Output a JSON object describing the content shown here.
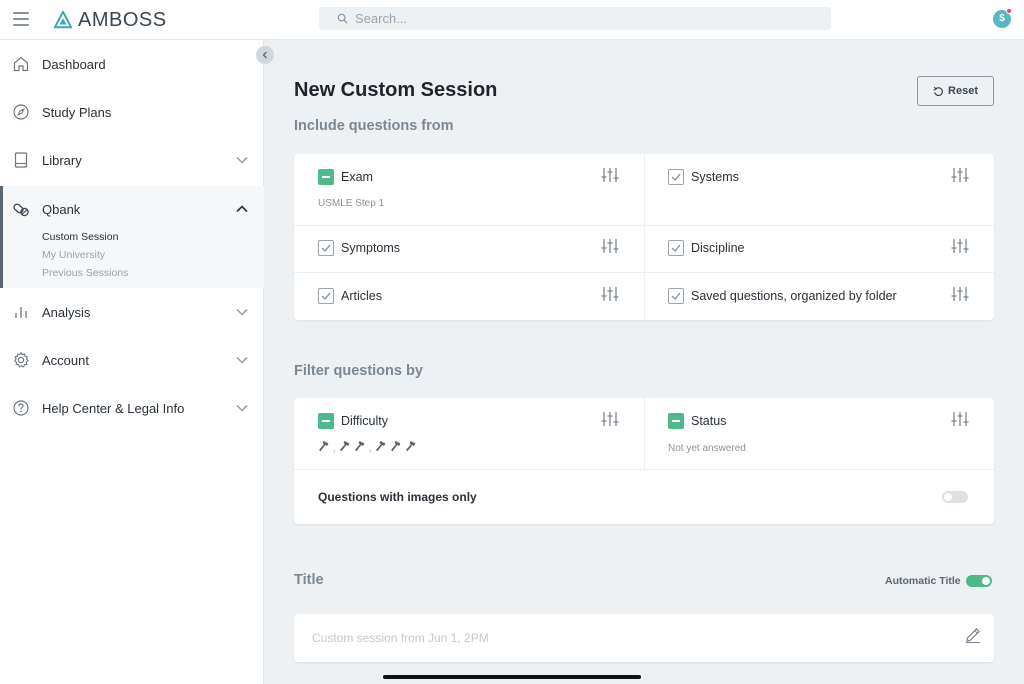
{
  "app": {
    "logo_text": "AMBOSS",
    "avatar_letter": "$"
  },
  "search": {
    "placeholder": "Search..."
  },
  "sidebar": {
    "items": [
      {
        "label": "Dashboard"
      },
      {
        "label": "Study Plans"
      },
      {
        "label": "Library"
      },
      {
        "label": "Qbank",
        "expanded": true,
        "sub_items": [
          {
            "label": "Custom Session",
            "active": true
          },
          {
            "label": "My University"
          },
          {
            "label": "Previous Sessions"
          }
        ]
      },
      {
        "label": "Analysis"
      },
      {
        "label": "Account"
      },
      {
        "label": "Help Center & Legal Info"
      }
    ]
  },
  "main": {
    "title": "New Custom Session",
    "reset_label": "Reset",
    "include_heading": "Include questions from",
    "include": {
      "exam": {
        "label": "Exam",
        "sub": "USMLE Step 1",
        "state": "partial"
      },
      "systems": {
        "label": "Systems",
        "state": "checked"
      },
      "symptoms": {
        "label": "Symptoms",
        "state": "checked"
      },
      "discipline": {
        "label": "Discipline",
        "state": "checked"
      },
      "articles": {
        "label": "Articles",
        "state": "checked"
      },
      "saved": {
        "label": "Saved questions, organized by folder",
        "state": "checked"
      }
    },
    "filter_heading": "Filter questions by",
    "filter": {
      "difficulty": {
        "label": "Difficulty",
        "state": "partial"
      },
      "status": {
        "label": "Status",
        "sub": "Not yet answered",
        "state": "partial"
      },
      "images_only": {
        "label": "Questions with images only",
        "enabled": false
      }
    },
    "title_section": {
      "label": "Title",
      "auto_title_label": "Automatic Title",
      "auto_title_enabled": true,
      "input_placeholder": "Custom session from Jun 1, 2PM"
    }
  },
  "colors": {
    "accent_green": "#4fb98a",
    "avatar_teal": "#5ab7c0",
    "notification_red": "#e0486a"
  },
  "icons": [
    "menu-icon",
    "amboss-logo-icon",
    "search-icon",
    "home-icon",
    "compass-icon",
    "book-icon",
    "pill-icon",
    "bar-chart-icon",
    "gear-icon",
    "help-icon",
    "chevron-down-icon",
    "chevron-up-icon",
    "chevron-left-icon",
    "reset-icon",
    "tune-icon",
    "hammer-icon",
    "pencil-icon"
  ]
}
